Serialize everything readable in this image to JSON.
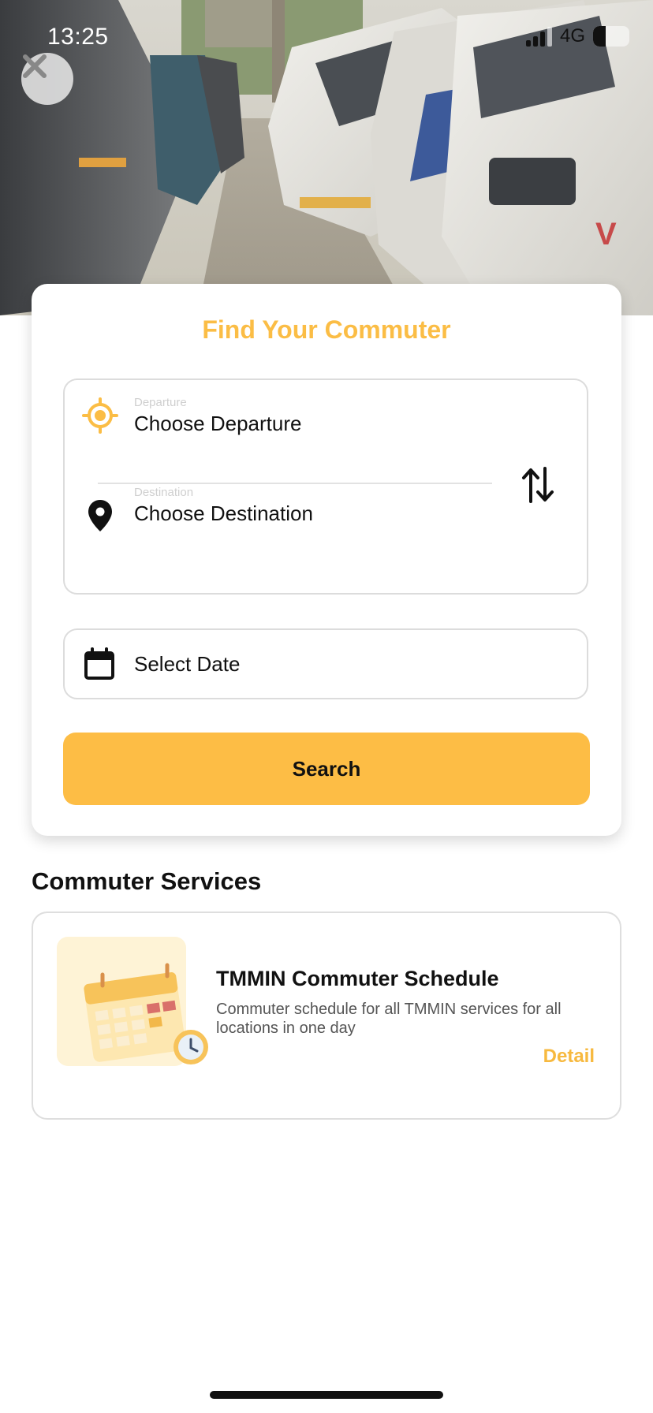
{
  "status_bar": {
    "time": "13:25",
    "network": "4G",
    "signal_icon": "signal-bars-icon",
    "battery_icon": "battery-icon",
    "battery_level": 0.35
  },
  "header": {
    "close_icon": "close-icon",
    "hero_image": "commuter-vans-photo"
  },
  "search_form": {
    "title": "Find Your Commuter",
    "departure": {
      "label": "Departure",
      "value": "Choose Departure",
      "icon": "crosshair-location-icon"
    },
    "destination": {
      "label": "Destination",
      "value": "Choose Destination",
      "icon": "map-pin-icon"
    },
    "swap_icon": "swap-arrows-icon",
    "date": {
      "value": "Select Date",
      "icon": "calendar-icon"
    },
    "search_label": "Search"
  },
  "services": {
    "section_title": "Commuter Services",
    "items": [
      {
        "title": "TMMIN Commuter Schedule",
        "description": "Commuter schedule for all TMMIN services for all locations in one day",
        "link_label": "Detail",
        "icon": "calendar-clock-illustration"
      }
    ]
  },
  "colors": {
    "accent": "#FDBD45",
    "title_accent": "#FBBD45",
    "text": "#111111",
    "muted": "#555555",
    "border": "#DCDCDC"
  }
}
